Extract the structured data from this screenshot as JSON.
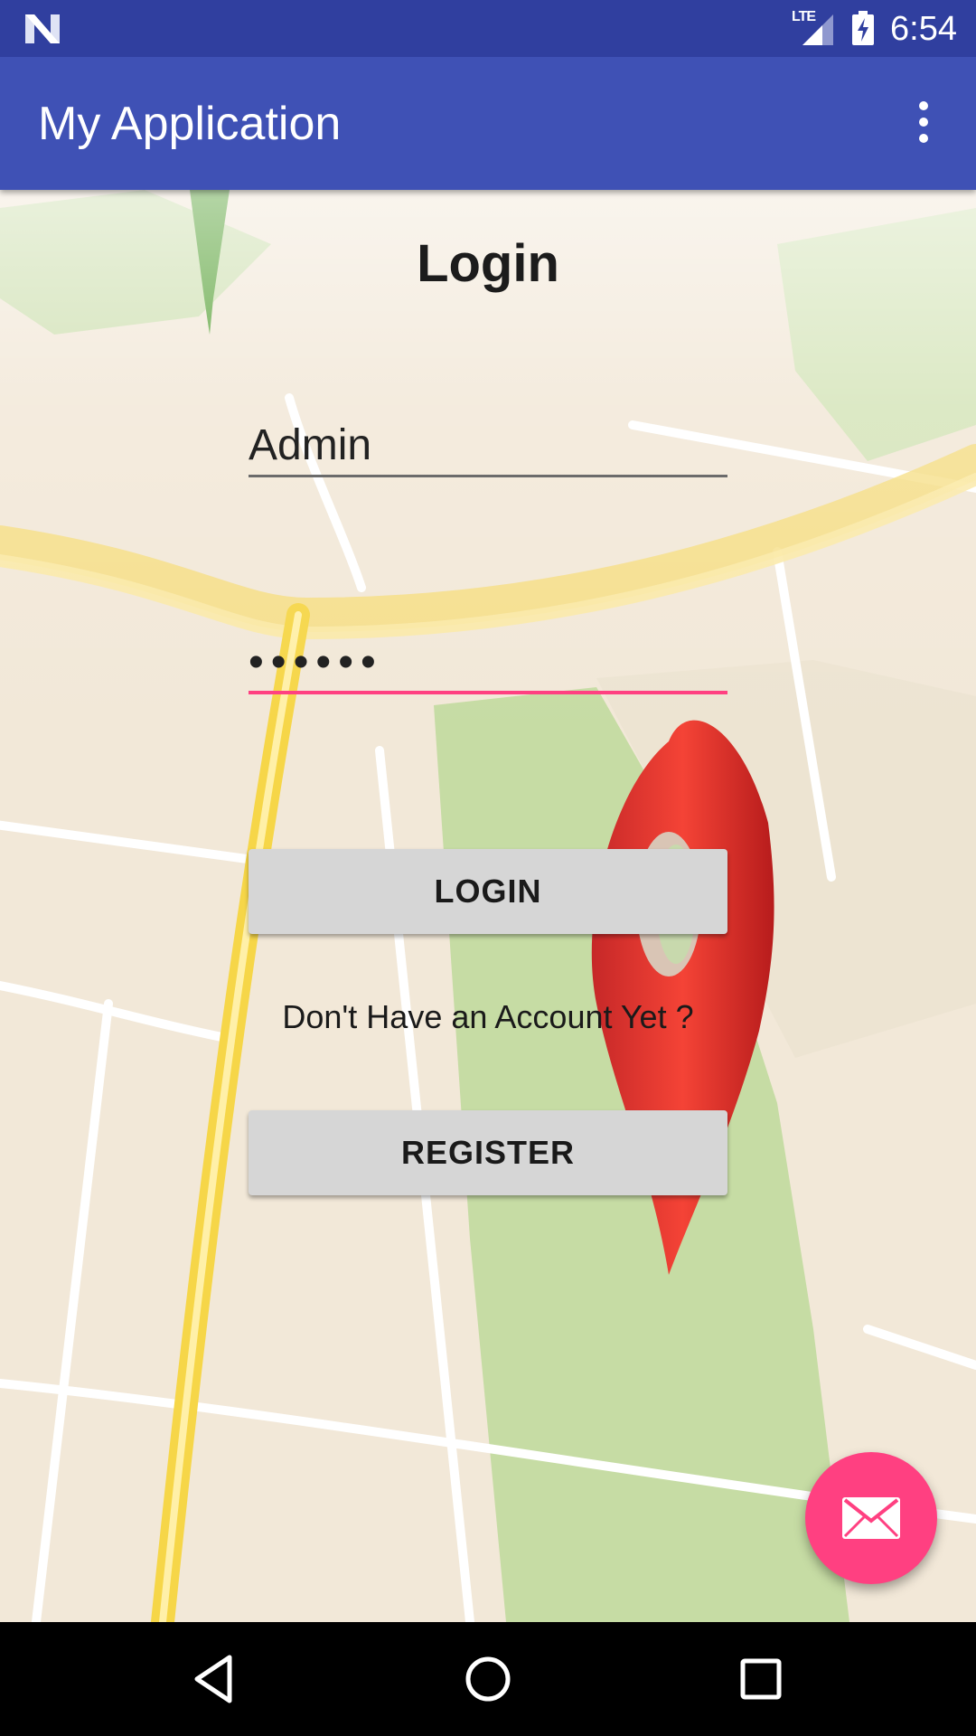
{
  "status_bar": {
    "network": "LTE",
    "time": "6:54",
    "icons": [
      "n-logo-icon",
      "signal-icon",
      "battery-charging-icon"
    ]
  },
  "app_bar": {
    "title": "My Application",
    "overflow_icon": "more-vert-icon"
  },
  "login": {
    "title": "Login",
    "username_value": "Admin",
    "password_value": "••••••",
    "login_button": "LOGIN",
    "no_account_text": "Don't Have an Account Yet ?",
    "register_button": "REGISTER"
  },
  "fab": {
    "icon": "mail-icon"
  },
  "nav_bar": {
    "icons": [
      "back-icon",
      "home-icon",
      "recents-icon"
    ]
  },
  "colors": {
    "status_bar": "#303f9f",
    "app_bar": "#3f51b5",
    "accent": "#ff4081",
    "button": "#d6d6d6"
  }
}
